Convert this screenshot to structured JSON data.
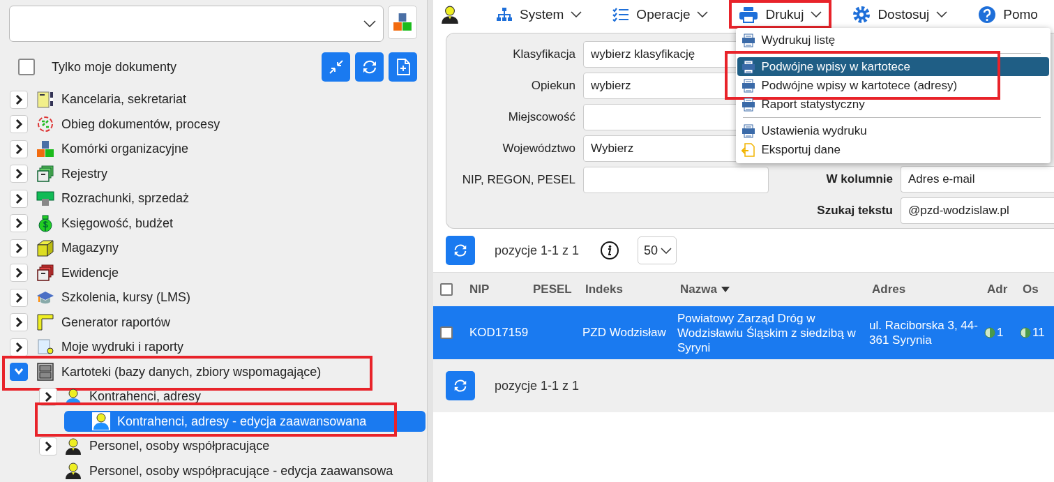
{
  "left_panel": {
    "only_mine": {
      "label": "Tylko moje dokumenty",
      "checked": false
    },
    "tree": {
      "items": [
        {
          "label": "Kancelaria, sekretariat",
          "expanded": false,
          "selected": false,
          "highlighted": false
        },
        {
          "label": "Obieg dokumentów, procesy",
          "expanded": false,
          "selected": false,
          "highlighted": false
        },
        {
          "label": "Komórki organizacyjne",
          "expanded": false,
          "selected": false,
          "highlighted": false
        },
        {
          "label": "Rejestry",
          "expanded": false,
          "selected": false,
          "highlighted": false
        },
        {
          "label": "Rozrachunki, sprzedaż",
          "expanded": false,
          "selected": false,
          "highlighted": false
        },
        {
          "label": "Księgowość, budżet",
          "expanded": false,
          "selected": false,
          "highlighted": false
        },
        {
          "label": "Magazyny",
          "expanded": false,
          "selected": false,
          "highlighted": false
        },
        {
          "label": "Ewidencje",
          "expanded": false,
          "selected": false,
          "highlighted": false
        },
        {
          "label": "Szkolenia, kursy (LMS)",
          "expanded": false,
          "selected": false,
          "highlighted": false
        },
        {
          "label": "Generator raportów",
          "expanded": false,
          "selected": false,
          "highlighted": false
        },
        {
          "label": "Moje wydruki i raporty",
          "expanded": false,
          "selected": false,
          "highlighted": false
        },
        {
          "label": "Kartoteki (bazy danych, zbiory wspomagające)",
          "expanded": true,
          "selected": false,
          "highlighted": true,
          "children": [
            {
              "label": "Kontrahenci, adresy",
              "expanded": false,
              "selected": false,
              "highlighted": false
            },
            {
              "label": "Kontrahenci, adresy - edycja zaawansowana",
              "selected": true,
              "highlighted": true
            },
            {
              "label": "Personel, osoby współpracujące",
              "expanded": false,
              "selected": false,
              "highlighted": false
            },
            {
              "label": "Personel, osoby współpracujące - edycja zaawansowa",
              "selected": false,
              "highlighted": false
            }
          ]
        }
      ]
    }
  },
  "menu_bar": {
    "items": [
      {
        "label": "System",
        "open": false,
        "highlighted": false
      },
      {
        "label": "Operacje",
        "open": false,
        "highlighted": false
      },
      {
        "label": "Drukuj",
        "open": true,
        "highlighted": true
      },
      {
        "label": "Dostosuj",
        "open": false,
        "highlighted": false
      },
      {
        "label": "Pomo",
        "open": false,
        "highlighted": false
      }
    ]
  },
  "print_menu": {
    "items": [
      {
        "kind": "item",
        "label": "Wydrukuj listę",
        "selected": false,
        "highlighted": false
      },
      {
        "kind": "separator"
      },
      {
        "kind": "item",
        "label": "Podwójne wpisy w kartotece",
        "selected": true,
        "highlighted": true
      },
      {
        "kind": "item",
        "label": "Podwójne wpisy w kartotece (adresy)",
        "selected": false,
        "highlighted": true
      },
      {
        "kind": "item",
        "label": "Raport statystyczny",
        "selected": false,
        "highlighted": false
      },
      {
        "kind": "separator"
      },
      {
        "kind": "item",
        "label": "Ustawienia wydruku",
        "selected": false,
        "highlighted": false
      },
      {
        "kind": "export",
        "label": "Eksportuj dane",
        "selected": false,
        "highlighted": false
      }
    ]
  },
  "filters": {
    "left": [
      {
        "label": "Klasyfikacja",
        "value": "wybierz klasyfikację"
      },
      {
        "label": "Opiekun",
        "value": "wybierz"
      },
      {
        "label": "Miejscowość"
      },
      {
        "label": "Województwo",
        "value": "Wybierz"
      },
      {
        "label": "NIP, REGON, PESEL"
      }
    ],
    "right": [
      {
        "label": "W kolumnie",
        "value": "Adres e-mail"
      },
      {
        "label": "Szukaj tekstu",
        "value": "@pzd-wodzislaw.pl"
      }
    ]
  },
  "pager_top": {
    "text": "pozycje 1-1 z 1",
    "page_size": "50"
  },
  "table": {
    "select_all_checked": false,
    "columns": [
      {
        "label": "NIP",
        "sorted": false
      },
      {
        "label": "PESEL",
        "sorted": false
      },
      {
        "label": "Indeks",
        "sorted": false
      },
      {
        "label": "Nazwa",
        "sorted": true
      },
      {
        "label": "Adres",
        "sorted": false
      },
      {
        "label": "Adr",
        "sorted": false
      },
      {
        "label": "Os",
        "sorted": false
      }
    ],
    "rows": [
      {
        "selected": true,
        "checked": false,
        "nip": "KOD17159",
        "indeks": "PZD Wodzisław",
        "nazwa": "Powiatowy Zarząd Dróg w Wodzisławiu Śląskim z siedzibą w Syryni",
        "adres": "ul. Raciborska 3, 44-361 Syrynia",
        "adr": "1",
        "os": "11"
      }
    ]
  },
  "pager_bottom": {
    "text": "pozycje 1-1 z 1"
  }
}
